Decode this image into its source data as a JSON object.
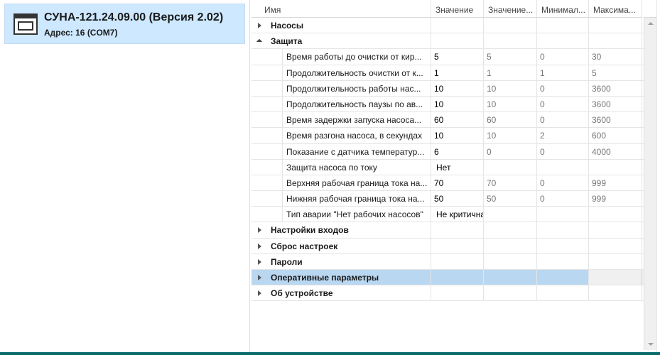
{
  "device": {
    "title": "СУНА-121.24.09.00 (Версия 2.02)",
    "address": "Адрес: 16 (COM7)",
    "icon": "device-window-icon"
  },
  "grid": {
    "columns": [
      "Имя",
      "Значение",
      "Значение...",
      "Минимал...",
      "Максима..."
    ],
    "groups_top": [
      {
        "name": "Насосы",
        "expanded": false
      }
    ],
    "protection": {
      "name": "Защита",
      "expanded": true,
      "items": [
        {
          "name": "Время работы до очистки от кир...",
          "value": "5",
          "default": "5",
          "min": "0",
          "max": "30"
        },
        {
          "name": "Продолжительность очистки от к...",
          "value": "1",
          "default": "1",
          "min": "1",
          "max": "5"
        },
        {
          "name": "Продолжительность  работы нас...",
          "value": "10",
          "default": "10",
          "min": "0",
          "max": "3600"
        },
        {
          "name": "Продолжительность паузы по ав...",
          "value": "10",
          "default": "10",
          "min": "0",
          "max": "3600"
        },
        {
          "name": "Время задержки запуска насоса...",
          "value": "60",
          "default": "60",
          "min": "0",
          "max": "3600"
        },
        {
          "name": "Время разгона насоса, в секундах",
          "value": "10",
          "default": "10",
          "min": "2",
          "max": "600"
        },
        {
          "name": "Показание с датчика температур...",
          "value": "6",
          "default": "0",
          "min": "0",
          "max": "4000"
        },
        {
          "name": "Защита насоса по току",
          "value": "Нет",
          "default": "",
          "min": "",
          "max": "",
          "text": true
        },
        {
          "name": "Верхняя рабочая граница тока на...",
          "value": "70",
          "default": "70",
          "min": "0",
          "max": "999"
        },
        {
          "name": "Нижняя рабочая граница тока на...",
          "value": "50",
          "default": "50",
          "min": "0",
          "max": "999"
        },
        {
          "name": "Тип аварии \"Нет рабочих насосов\"",
          "value": "Не критична",
          "default": "",
          "min": "",
          "max": "",
          "text": true
        }
      ]
    },
    "groups_bottom": [
      {
        "name": "Настройки входов",
        "selected": false
      },
      {
        "name": "Сброс настроек",
        "selected": false
      },
      {
        "name": "Пароли",
        "selected": false
      },
      {
        "name": "Оперативные параметры",
        "selected": true
      },
      {
        "name": "Об устройстве",
        "selected": false
      }
    ]
  },
  "colors": {
    "selection": "#cde8ff",
    "row_selected": "#b9d7f0",
    "bottom_bar": "#0b6b6b"
  }
}
